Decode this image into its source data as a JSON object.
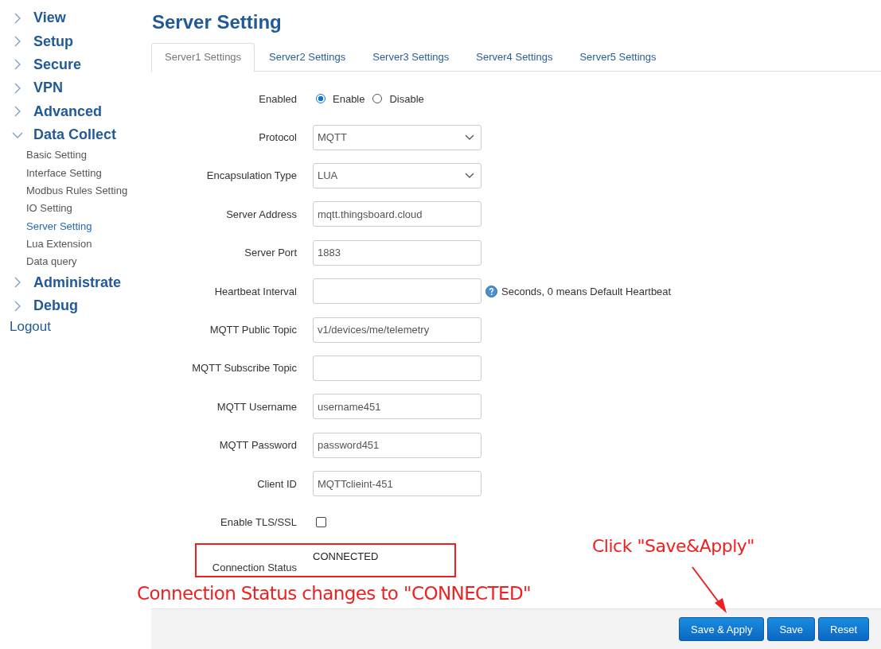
{
  "sidebar": {
    "items": [
      {
        "label": "View",
        "expanded": false
      },
      {
        "label": "Setup",
        "expanded": false
      },
      {
        "label": "Secure",
        "expanded": false
      },
      {
        "label": "VPN",
        "expanded": false
      },
      {
        "label": "Advanced",
        "expanded": false
      },
      {
        "label": "Data Collect",
        "expanded": true,
        "children": [
          {
            "label": "Basic Setting",
            "selected": false
          },
          {
            "label": "Interface Setting",
            "selected": false
          },
          {
            "label": "Modbus Rules Setting",
            "selected": false
          },
          {
            "label": "IO Setting",
            "selected": false
          },
          {
            "label": "Server Setting",
            "selected": true
          },
          {
            "label": "Lua Extension",
            "selected": false
          },
          {
            "label": "Data query",
            "selected": false
          }
        ]
      },
      {
        "label": "Administrate",
        "expanded": false
      },
      {
        "label": "Debug",
        "expanded": false
      }
    ],
    "logout": "Logout"
  },
  "page": {
    "title": "Server Setting",
    "tabs": [
      {
        "label": "Server1 Settings",
        "selected": true
      },
      {
        "label": "Server2 Settings",
        "selected": false
      },
      {
        "label": "Server3 Settings",
        "selected": false
      },
      {
        "label": "Server4 Settings",
        "selected": false
      },
      {
        "label": "Server5 Settings",
        "selected": false
      }
    ],
    "fields": [
      {
        "kind": "radio",
        "label": "Enabled",
        "options": [
          {
            "label": "Enable",
            "selected": true
          },
          {
            "label": "Disable",
            "selected": false
          }
        ]
      },
      {
        "kind": "select",
        "label": "Protocol",
        "value": "MQTT"
      },
      {
        "kind": "select",
        "label": "Encapsulation Type",
        "value": "LUA"
      },
      {
        "kind": "text",
        "label": "Server Address",
        "value": "mqtt.thingsboard.cloud"
      },
      {
        "kind": "text",
        "label": "Server Port",
        "value": "1883"
      },
      {
        "kind": "text",
        "label": "Heartbeat Interval",
        "hint": "Seconds, 0 means Default Heartbeat"
      },
      {
        "kind": "text",
        "label": "MQTT Public Topic",
        "value": "v1/devices/me/telemetry"
      },
      {
        "kind": "text",
        "label": "MQTT Subscribe Topic"
      },
      {
        "kind": "text",
        "label": "MQTT Username",
        "value": "username451"
      },
      {
        "kind": "text",
        "label": "MQTT Password",
        "value": "password451"
      },
      {
        "kind": "text",
        "label": "Client ID",
        "value": "MQTTclieint-451"
      },
      {
        "kind": "checkbox",
        "label": "Enable TLS/SSL",
        "checked": false
      },
      {
        "kind": "status",
        "label": "Connection Status",
        "value": "CONNECTED",
        "highlighted": true
      }
    ],
    "buttons": [
      "Save & Apply",
      "Save",
      "Reset"
    ]
  },
  "annotations": {
    "status_note": "Connection Status changes to \"CONNECTED\"",
    "click_note": "Click \"Save&Apply\""
  }
}
